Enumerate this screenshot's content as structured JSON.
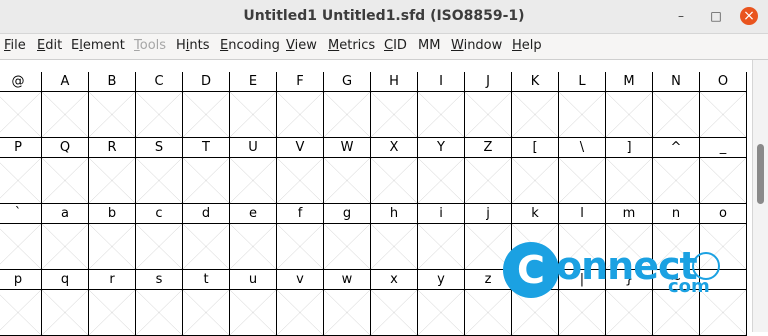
{
  "window": {
    "title": "Untitled1  Untitled1.sfd (ISO8859-1)",
    "controls": {
      "minimize": "–",
      "maximize": "□",
      "close": "×"
    }
  },
  "menu": [
    {
      "label": "File",
      "mnemonic": "F",
      "disabled": false
    },
    {
      "label": "Edit",
      "mnemonic": "E",
      "disabled": false
    },
    {
      "label": "Element",
      "mnemonic": "l",
      "disabled": false
    },
    {
      "label": "Tools",
      "mnemonic": "T",
      "disabled": true
    },
    {
      "label": "Hints",
      "mnemonic": "i",
      "disabled": false
    },
    {
      "label": "Encoding",
      "mnemonic": "E",
      "disabled": false
    },
    {
      "label": "View",
      "mnemonic": "V",
      "disabled": false
    },
    {
      "label": "Metrics",
      "mnemonic": "M",
      "disabled": false
    },
    {
      "label": "CID",
      "mnemonic": "C",
      "disabled": false
    },
    {
      "label": "MM",
      "mnemonic": "",
      "disabled": false
    },
    {
      "label": "Window",
      "mnemonic": "W",
      "disabled": false
    },
    {
      "label": "Help",
      "mnemonic": "H",
      "disabled": false
    }
  ],
  "glyph_rows": [
    [
      "@",
      "A",
      "B",
      "C",
      "D",
      "E",
      "F",
      "G",
      "H",
      "I",
      "J",
      "K",
      "L",
      "M",
      "N",
      "O"
    ],
    [
      "P",
      "Q",
      "R",
      "S",
      "T",
      "U",
      "V",
      "W",
      "X",
      "Y",
      "Z",
      "[",
      "\\",
      "]",
      "^",
      "_"
    ],
    [
      "`",
      "a",
      "b",
      "c",
      "d",
      "e",
      "f",
      "g",
      "h",
      "i",
      "j",
      "k",
      "l",
      "m",
      "n",
      "o"
    ],
    [
      "p",
      "q",
      "r",
      "s",
      "t",
      "u",
      "v",
      "w",
      "x",
      "y",
      "z",
      "{",
      "|",
      "}",
      "~",
      ""
    ]
  ],
  "watermark": {
    "brand": "onnect",
    "sub": "com",
    "letter": "C"
  },
  "colors": {
    "accent": "#1ba1e2",
    "close": "#e9541e",
    "grid": "#000000",
    "cross": "#909090"
  }
}
